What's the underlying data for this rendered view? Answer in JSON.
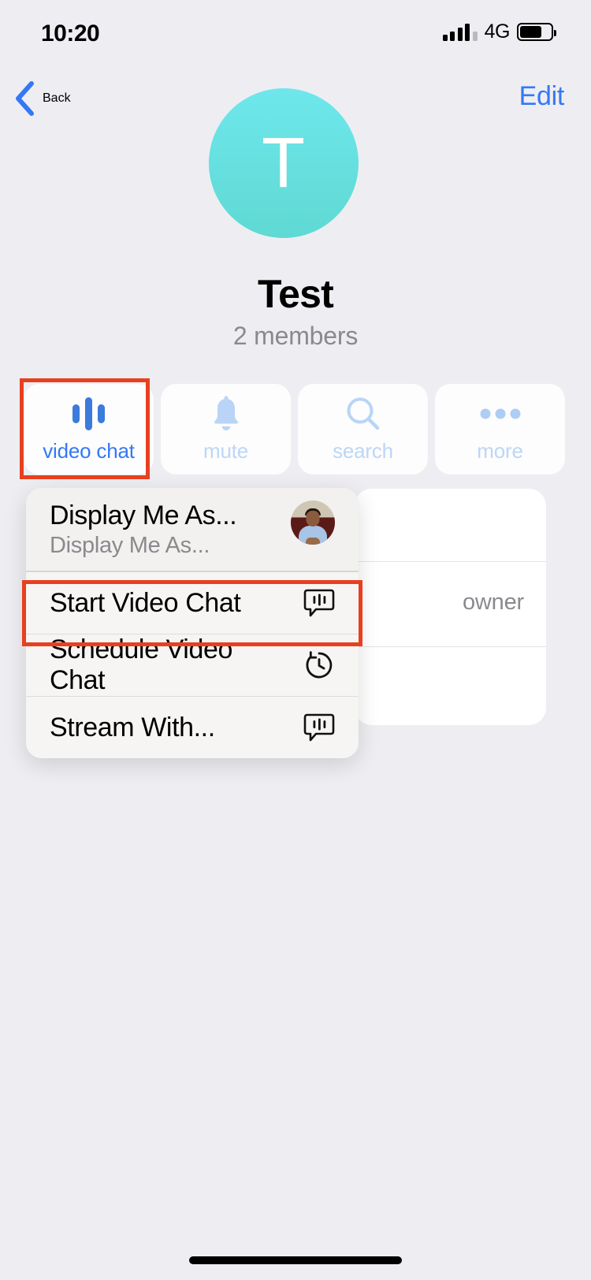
{
  "status_bar": {
    "time": "10:20",
    "network": "4G",
    "signal_icon": "signal-bars-icon",
    "battery_icon": "battery-icon"
  },
  "nav": {
    "back_label": "Back",
    "back_icon": "chevron-left-icon",
    "edit_label": "Edit"
  },
  "profile": {
    "avatar_letter": "T",
    "avatar_color": "#5fd9d3",
    "title": "Test",
    "subtitle": "2 members"
  },
  "actions": [
    {
      "label": "video chat",
      "icon": "video-chat-bars-icon",
      "state": "active",
      "color": "#3478f6"
    },
    {
      "label": "mute",
      "icon": "bell-icon",
      "state": "dim",
      "color": "#bcd6f7"
    },
    {
      "label": "search",
      "icon": "magnifier-icon",
      "state": "dim",
      "color": "#bcd6f7"
    },
    {
      "label": "more",
      "icon": "ellipsis-icon",
      "state": "dim",
      "color": "#bcd6f7"
    }
  ],
  "context_menu": {
    "items": [
      {
        "title": "Display Me As...",
        "subtitle": "Display Me As...",
        "trailing": "user-avatar-photo"
      },
      {
        "title": "Start Video Chat",
        "trailing_icon": "video-chat-bubble-icon",
        "highlighted": true
      },
      {
        "title": "Schedule Video Chat",
        "trailing_icon": "clock-arrow-icon"
      },
      {
        "title": "Stream With...",
        "trailing_icon": "stream-bubble-icon"
      }
    ]
  },
  "detail_card": {
    "owner_label": "owner"
  },
  "highlights": {
    "color": "#e8401f",
    "targets": [
      "video-chat-action-button",
      "start-video-chat-menu-item"
    ]
  },
  "home_indicator": {
    "label": "home-indicator"
  }
}
